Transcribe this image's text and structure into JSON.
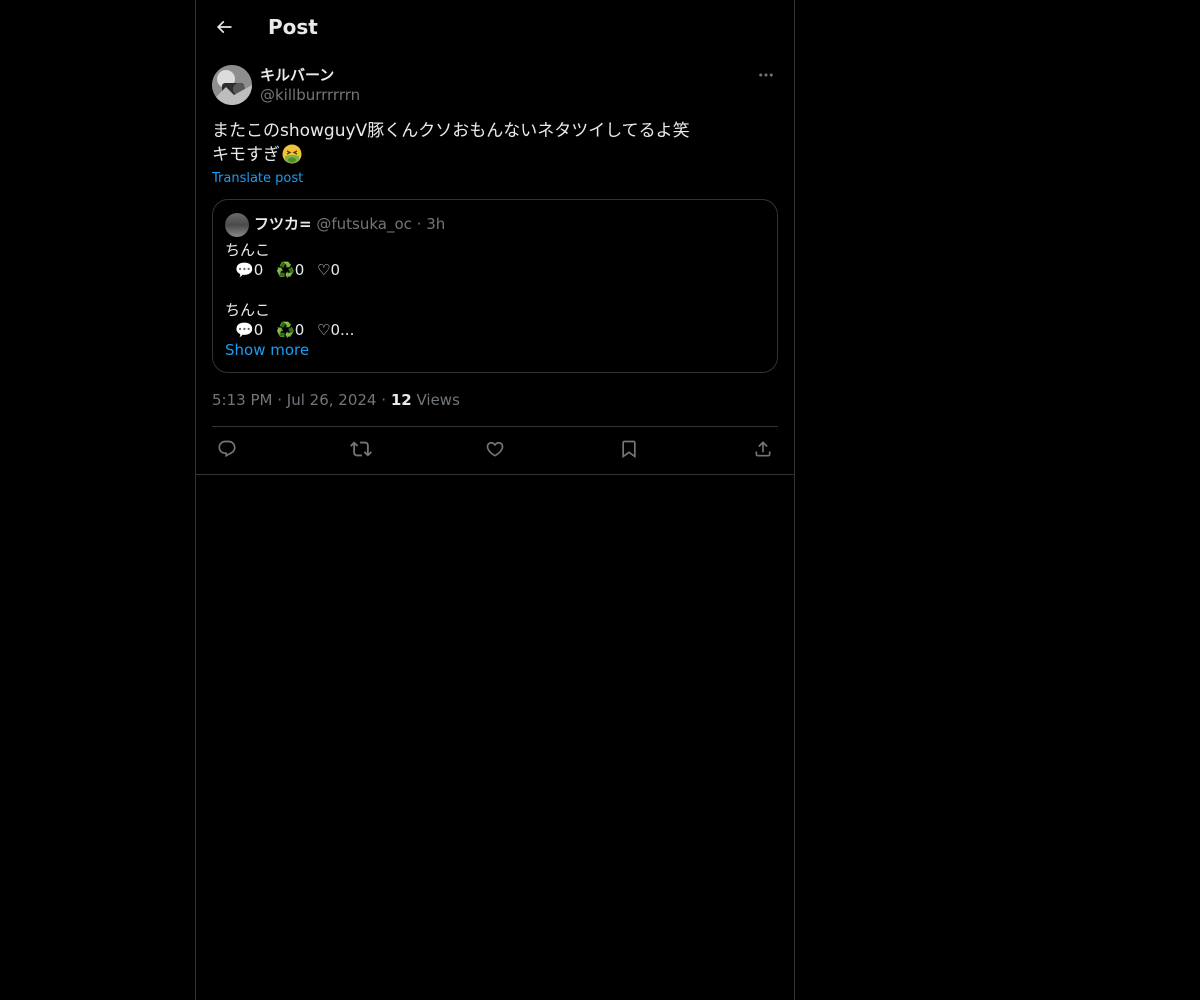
{
  "header": {
    "title": "Post"
  },
  "post": {
    "author_name": "キルバーン",
    "author_handle": "@killburrrrrrn",
    "text_line1": "またこのshowguyV豚くんクソおもんないネタツイしてるよ笑",
    "text_line2": "キモすぎ",
    "emoji": "face-vomiting-icon",
    "translate_label": "Translate post",
    "time": "5:13 PM",
    "date": "Jul 26, 2024",
    "views_count": "12",
    "views_label": "Views",
    "separator": "·"
  },
  "quote": {
    "author_name": "フツカ=",
    "author_handle": "@futsuka_oc",
    "separator": "·",
    "age": "3h",
    "blocks": [
      {
        "text": "ちんこ",
        "replies": "0",
        "reposts": "0",
        "likes": "0"
      },
      {
        "text": "ちんこ",
        "replies": "0",
        "reposts": "0",
        "likes": "0..."
      }
    ],
    "reply_glyph": "💬",
    "repost_glyph": "♻️",
    "like_glyph": "♡",
    "show_more_label": "Show more"
  },
  "actions": [
    {
      "icon": "reply-icon"
    },
    {
      "icon": "repost-icon"
    },
    {
      "icon": "like-icon"
    },
    {
      "icon": "bookmark-icon"
    },
    {
      "icon": "share-icon"
    }
  ],
  "colors": {
    "background": "#000000",
    "text": "#e7e9ea",
    "muted": "#71767b",
    "accent": "#1d9bf0",
    "border": "#2f3336"
  }
}
